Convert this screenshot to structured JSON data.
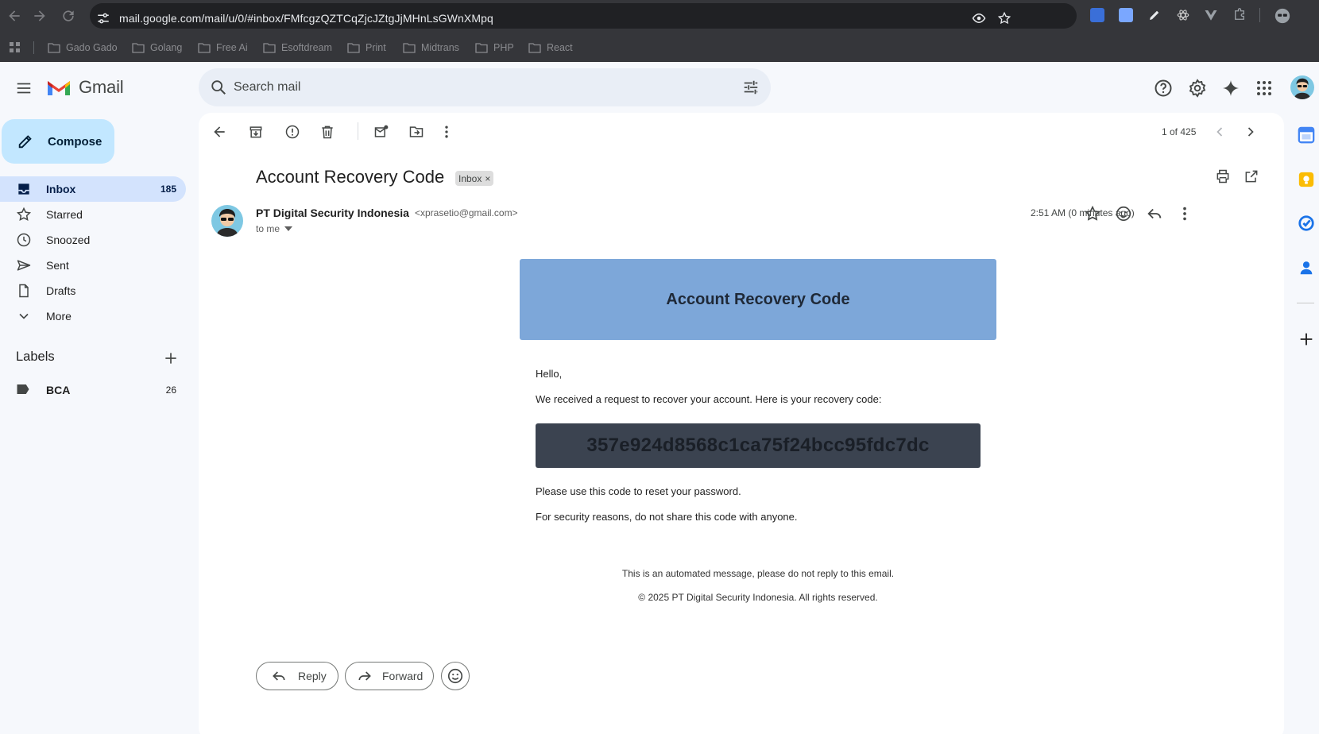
{
  "browser": {
    "url": "mail.google.com/mail/u/0/#inbox/FMfcgzQZTCqZjcJZtgJjMHnLsGWnXMpq",
    "bookmarks": [
      "Gado Gado",
      "Golang",
      "Free Ai",
      "Esoftdream",
      "Print",
      "Midtrans",
      "PHP",
      "React"
    ],
    "extension_colors": [
      "#4f86f7",
      "#7aa7ff",
      "#e8eaed",
      "#c9c9c9",
      "#9aa0a6",
      "#9aa0a6"
    ]
  },
  "header": {
    "app_name": "Gmail",
    "search_placeholder": "Search mail",
    "icons": [
      "help-icon",
      "settings-icon",
      "gemini-icon",
      "apps-icon"
    ]
  },
  "sidebar": {
    "compose_label": "Compose",
    "items": [
      {
        "label": "Inbox",
        "count": "185",
        "icon": "inbox-icon",
        "active": true
      },
      {
        "label": "Starred",
        "count": "",
        "icon": "star-icon"
      },
      {
        "label": "Snoozed",
        "count": "",
        "icon": "clock-icon"
      },
      {
        "label": "Sent",
        "count": "",
        "icon": "send-icon"
      },
      {
        "label": "Drafts",
        "count": "",
        "icon": "draft-icon"
      },
      {
        "label": "More",
        "count": "",
        "icon": "chevron-down-icon"
      }
    ],
    "labels_heading": "Labels",
    "labels": [
      {
        "name": "BCA",
        "count": "26"
      }
    ]
  },
  "toolbar": {
    "pager": "1 of 425"
  },
  "email": {
    "subject": "Account Recovery Code",
    "chip": "Inbox",
    "chip_close": "×",
    "sender_name": "PT Digital Security Indonesia",
    "sender_email": "<xprasetio@gmail.com>",
    "to": "to me",
    "time": "2:51 AM (0 minutes ago)",
    "body": {
      "banner_title": "Account Recovery Code",
      "greeting": "Hello,",
      "intro": "We received a request to recover your account. Here is your recovery code:",
      "code": "357e924d8568c1ca75f24bcc95fdc7dc",
      "instruction": "Please use this code to reset your password.",
      "warning": "For security reasons, do not share this code with anyone.",
      "footer_note": "This is an automated message, please do not reply to this email.",
      "copyright": "© 2025 PT Digital Security Indonesia. All rights reserved."
    },
    "reply_label": "Reply",
    "forward_label": "Forward"
  },
  "colors": {
    "banner": "#7da7d9",
    "code_box": "#3b4350",
    "compose": "#c2e7ff",
    "active_nav": "#d3e3fd"
  }
}
